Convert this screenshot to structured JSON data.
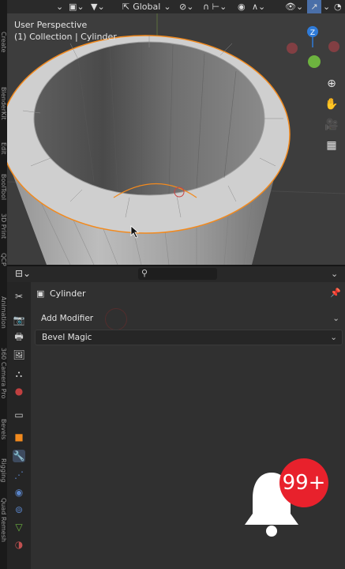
{
  "viewport": {
    "perspective_label": "User Perspective",
    "collection_label": "(1) Collection | Cylinder",
    "transform_orientation": "Global"
  },
  "gizmo": {
    "z_label": "Z",
    "colors": {
      "z": "#2f7bd8",
      "y": "#6db33f",
      "x": "#d8434b"
    }
  },
  "tabstrip": {
    "tabs": [
      "Create",
      "BlenderKit",
      "Edit",
      "BoolTool",
      "3D Print",
      "QCP",
      "Animation",
      "360 Camera Pro",
      "Bevels",
      "Rigging",
      "Quad Remesh"
    ]
  },
  "properties": {
    "object_name": "Cylinder",
    "add_modifier_label": "Add Modifier",
    "modifier_name": "Bevel Magic"
  },
  "notification": {
    "count": "99+"
  },
  "colors": {
    "selection_outline": "#f28a1e",
    "active_tab": "#5a84c8",
    "badge": "#e8212c"
  }
}
